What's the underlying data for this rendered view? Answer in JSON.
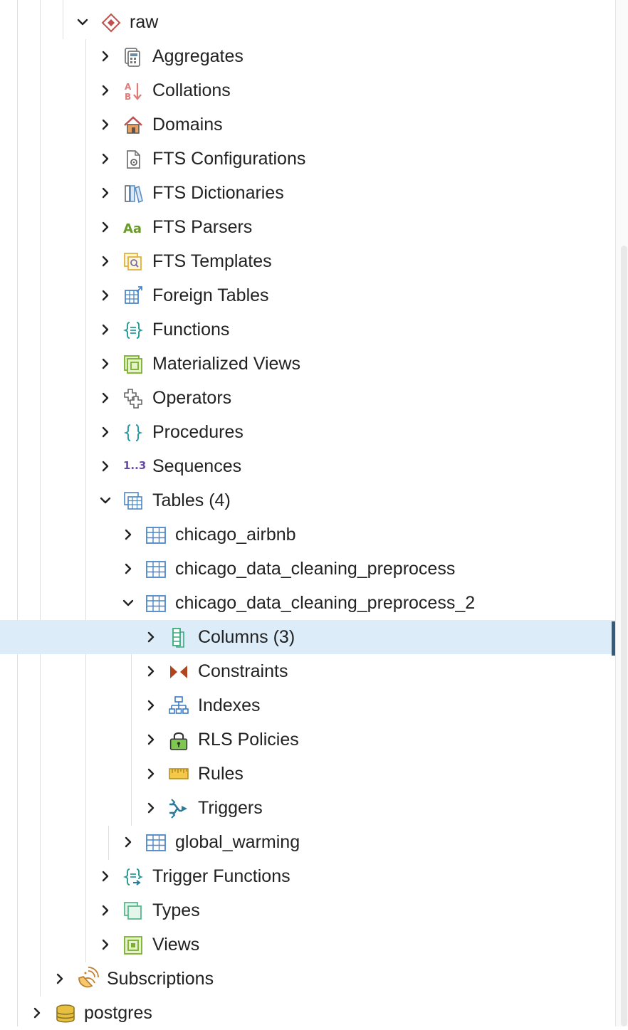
{
  "tree": {
    "schema": {
      "label": "raw",
      "icon": "schema-icon"
    },
    "groups": [
      {
        "label": "Aggregates",
        "icon": "aggregates-icon"
      },
      {
        "label": "Collations",
        "icon": "collations-icon"
      },
      {
        "label": "Domains",
        "icon": "domains-icon"
      },
      {
        "label": "FTS Configurations",
        "icon": "fts-configurations-icon"
      },
      {
        "label": "FTS Dictionaries",
        "icon": "fts-dictionaries-icon"
      },
      {
        "label": "FTS Parsers",
        "icon": "fts-parsers-icon"
      },
      {
        "label": "FTS Templates",
        "icon": "fts-templates-icon"
      },
      {
        "label": "Foreign Tables",
        "icon": "foreign-tables-icon"
      },
      {
        "label": "Functions",
        "icon": "functions-icon"
      },
      {
        "label": "Materialized Views",
        "icon": "materialized-views-icon"
      },
      {
        "label": "Operators",
        "icon": "operators-icon"
      },
      {
        "label": "Procedures",
        "icon": "procedures-icon"
      },
      {
        "label": "Sequences",
        "icon": "sequences-icon"
      },
      {
        "label": "Tables (4)",
        "icon": "tables-icon"
      }
    ],
    "tables": [
      {
        "label": "chicago_airbnb",
        "icon": "table-icon"
      },
      {
        "label": "chicago_data_cleaning_preprocess",
        "icon": "table-icon"
      },
      {
        "label": "chicago_data_cleaning_preprocess_2",
        "icon": "table-icon"
      }
    ],
    "table_children": [
      {
        "label": "Columns (3)",
        "icon": "columns-icon",
        "selected": true
      },
      {
        "label": "Constraints",
        "icon": "constraints-icon"
      },
      {
        "label": "Indexes",
        "icon": "indexes-icon"
      },
      {
        "label": "RLS Policies",
        "icon": "rls-policies-icon"
      },
      {
        "label": "Rules",
        "icon": "rules-icon"
      },
      {
        "label": "Triggers",
        "icon": "triggers-icon"
      }
    ],
    "last_table": {
      "label": "global_warming",
      "icon": "table-icon"
    },
    "groups_after": [
      {
        "label": "Trigger Functions",
        "icon": "trigger-functions-icon"
      },
      {
        "label": "Types",
        "icon": "types-icon"
      },
      {
        "label": "Views",
        "icon": "views-icon"
      }
    ],
    "subscriptions": {
      "label": "Subscriptions",
      "icon": "subscriptions-icon"
    },
    "database": {
      "label": "postgres",
      "icon": "database-icon"
    },
    "icon_text": {
      "collations": "A B",
      "fts_parsers": "Aa",
      "sequences": "1..3"
    }
  },
  "colors": {
    "selected_bg": "#dcecf8",
    "selected_marker": "#345b7a"
  }
}
